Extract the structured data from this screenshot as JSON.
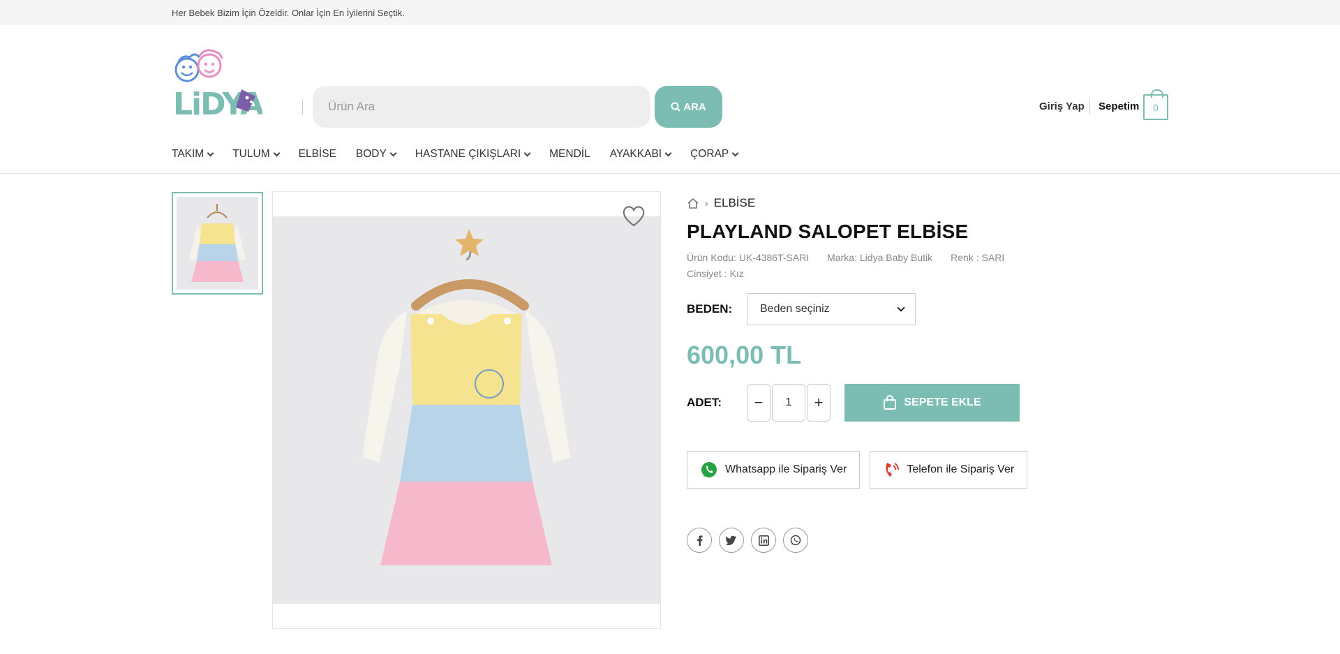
{
  "topbar": {
    "text": "Her Bebek Bizim İçin Özeldir. Onlar İçin En İyilerini Seçtik."
  },
  "header": {
    "logo_text": "LiDYA",
    "search_placeholder": "Ürün Ara",
    "search_button": "ARA",
    "login": "Giriş Yap",
    "cart_label": "Sepetim",
    "cart_count": "0"
  },
  "nav": {
    "items": [
      {
        "label": "TAKIM",
        "has_dropdown": true
      },
      {
        "label": "TULUM",
        "has_dropdown": true
      },
      {
        "label": "ELBİSE",
        "has_dropdown": false
      },
      {
        "label": "BODY",
        "has_dropdown": true
      },
      {
        "label": "HASTANE ÇIKIŞLARI",
        "has_dropdown": true
      },
      {
        "label": "MENDİL",
        "has_dropdown": false
      },
      {
        "label": "AYAKKABI",
        "has_dropdown": true
      },
      {
        "label": "ÇORAP",
        "has_dropdown": true
      }
    ]
  },
  "product": {
    "breadcrumb": "ELBİSE",
    "title": "PLAYLAND SALOPET ELBİSE",
    "code_label": "Ürün Kodu:",
    "code": "UK-4386T-SARI",
    "brand_label": "Marka:",
    "brand": "Lidya Baby Butik",
    "color_label": "Renk :",
    "color": "SARI",
    "gender_label": "Cinsiyet :",
    "gender": "Kız",
    "size_label": "BEDEN:",
    "size_placeholder": "Beden seçiniz",
    "price": "600,00 TL",
    "qty_label": "ADET:",
    "qty": "1",
    "add_to_cart": "SEPETE EKLE",
    "whatsapp_order": "Whatsapp ile Sipariş Ver",
    "phone_order": "Telefon ile Sipariş Ver"
  },
  "colors": {
    "accent": "#7bbdb2",
    "whatsapp": "#25a244",
    "phone": "#e53935"
  },
  "icons": [
    "search-icon",
    "home-icon",
    "heart-icon",
    "bag-icon",
    "whatsapp-icon",
    "phone-icon",
    "facebook-icon",
    "twitter-icon",
    "linkedin-icon"
  ]
}
